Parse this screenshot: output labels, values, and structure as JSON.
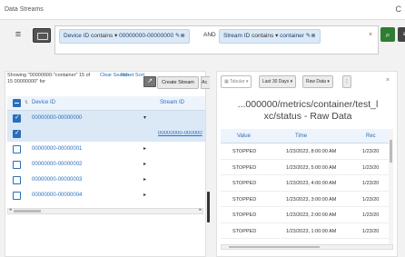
{
  "app": {
    "title": "Data Streams"
  },
  "filter": {
    "chip1": {
      "field": "Device ID",
      "op": "contains",
      "value": "00000000-00000000"
    },
    "conj": "AND",
    "chip2": {
      "field": "Stream ID",
      "op": "contains",
      "value": "container"
    },
    "clear": "×"
  },
  "left": {
    "showing": "Showing \"00000000-\"container\" 15 of 15 00000000\" for",
    "clear_search": "Clear Search",
    "reset_sort": "Reset Sort",
    "create_btn": "Create Stream",
    "ac_btn": "Ac",
    "headers": {
      "device": "Device ID",
      "stream": "Stream ID"
    },
    "rows": [
      {
        "device": "00000000-00000000",
        "stream": "",
        "checked": true
      },
      {
        "device": "",
        "stream": "00000000-000000",
        "checked": true
      },
      {
        "device": "00000000-00000001",
        "stream": "",
        "checked": false
      },
      {
        "device": "00000000-00000002",
        "stream": "",
        "checked": false
      },
      {
        "device": "00000000-00000003",
        "stream": "",
        "checked": false
      },
      {
        "device": "00000000-00000004",
        "stream": "",
        "checked": false
      }
    ]
  },
  "right": {
    "toolbar": {
      "tabular": "Tabular",
      "range": "Last 30 Days",
      "mode": "Raw Data",
      "more": "⋮"
    },
    "title_line1": "...000000/metrics/container/test_l",
    "title_line2": "xc/status - Raw Data",
    "headers": {
      "value": "Value",
      "time": "Time",
      "rec": "Rec"
    },
    "rows": [
      {
        "value": "STOPPED",
        "time": "1/23/2023, 8:00:00 AM",
        "rec": "1/23/20"
      },
      {
        "value": "STOPPED",
        "time": "1/23/2023, 5:00:00 AM",
        "rec": "1/23/20"
      },
      {
        "value": "STOPPED",
        "time": "1/23/2023, 4:00:00 AM",
        "rec": "1/23/20"
      },
      {
        "value": "STOPPED",
        "time": "1/23/2023, 3:00:00 AM",
        "rec": "1/23/20"
      },
      {
        "value": "STOPPED",
        "time": "1/23/2023, 2:00:00 AM",
        "rec": "1/23/20"
      },
      {
        "value": "STOPPED",
        "time": "1/23/2023, 1:00:00 AM",
        "rec": "1/23/20"
      }
    ]
  }
}
